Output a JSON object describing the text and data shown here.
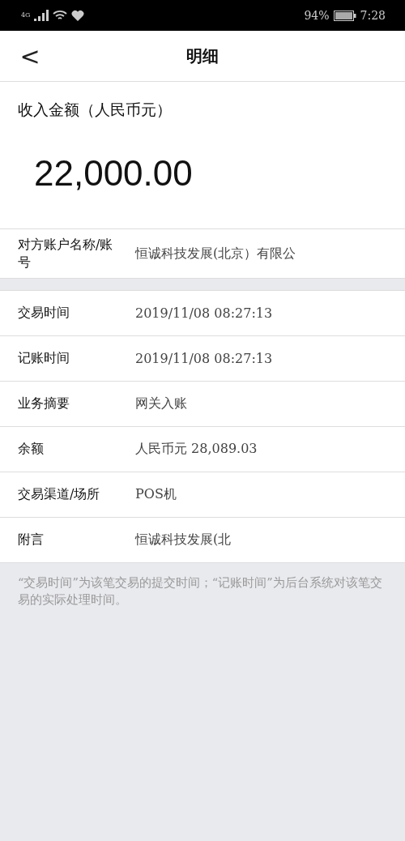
{
  "status_bar": {
    "network": "4G",
    "battery_percent": "94%",
    "time": "7:28"
  },
  "header": {
    "back": "<",
    "title": "明细"
  },
  "amount": {
    "label": "收入金额（人民币元）",
    "value": "22,000.00"
  },
  "counterparty": {
    "label": "对方账户名称/账号",
    "value": "恒诚科技发展(北京）有限公"
  },
  "details": [
    {
      "label": "交易时间",
      "value": "2019/11/08  08:27:13"
    },
    {
      "label": "记账时间",
      "value": "2019/11/08  08:27:13"
    },
    {
      "label": "业务摘要",
      "value": "网关入账"
    },
    {
      "label": "余额",
      "value": "人民币元 28,089.03"
    },
    {
      "label": "交易渠道/场所",
      "value": "POS机"
    },
    {
      "label": "附言",
      "value": "恒诚科技发展(北"
    }
  ],
  "note": "“交易时间”为该笔交易的提交时间；“记账时间”为后台系统对该笔交易的实际处理时间。"
}
